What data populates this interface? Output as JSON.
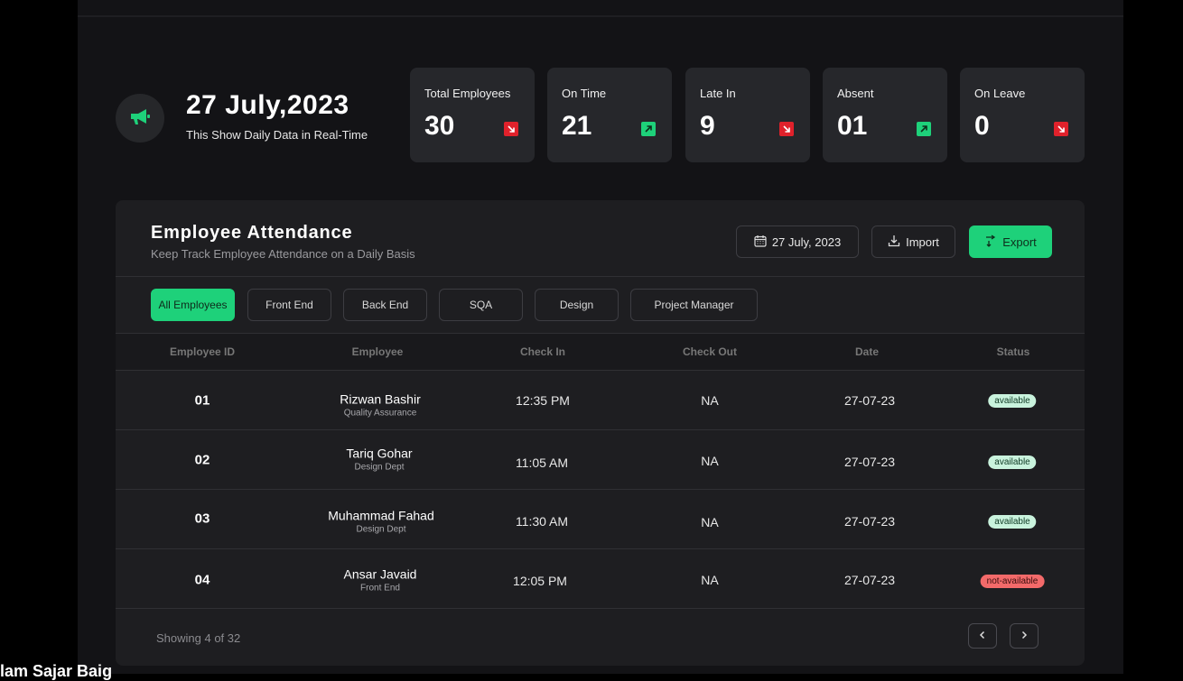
{
  "colors": {
    "accent": "#1ed17a",
    "down": "#e0212b",
    "bg": "#131316",
    "card": "#1e1e21"
  },
  "header": {
    "announce_icon": "megaphone-icon",
    "date": "27 July,2023",
    "subtitle": "This Show Daily Data in Real-Time"
  },
  "stats": [
    {
      "label": "Total Employees",
      "value": "30",
      "trend": "down"
    },
    {
      "label": "On Time",
      "value": "21",
      "trend": "up"
    },
    {
      "label": "Late In",
      "value": "9",
      "trend": "down"
    },
    {
      "label": "Absent",
      "value": "01",
      "trend": "up"
    },
    {
      "label": "On Leave",
      "value": "0",
      "trend": "down"
    }
  ],
  "attendance": {
    "title": "Employee Attendance",
    "subtitle": "Keep Track Employee Attendance on a Daily Basis",
    "date_button": "27 July, 2023",
    "import_label": "Import",
    "export_label": "Export",
    "tabs": [
      "All Employees",
      "Front End",
      "Back End",
      "SQA",
      "Design",
      "Project Manager"
    ],
    "columns": [
      "Employee ID",
      "Employee",
      "Check In",
      "Check Out",
      "Date",
      "Status"
    ],
    "rows": [
      {
        "id": "01",
        "name": "Rizwan Bashir",
        "dept": "Quality Assurance",
        "check_in": "12:35 PM",
        "check_out": "NA",
        "date": "27-07-23",
        "status": "available"
      },
      {
        "id": "02",
        "name": "Tariq Gohar",
        "dept": "Design Dept",
        "check_in": "11:05 AM",
        "check_out": "NA",
        "date": "27-07-23",
        "status": "available"
      },
      {
        "id": "03",
        "name": "Muhammad Fahad",
        "dept": "Design Dept",
        "check_in": "11:30 AM",
        "check_out": "NA",
        "date": "27-07-23",
        "status": "available"
      },
      {
        "id": "04",
        "name": "Ansar Javaid",
        "dept": "Front End",
        "check_in": "12:05 PM",
        "check_out": "NA",
        "date": "27-07-23",
        "status": "not-available"
      }
    ],
    "showing": "Showing 4 of 32"
  },
  "bottom_text": "lam Sajar Baig"
}
